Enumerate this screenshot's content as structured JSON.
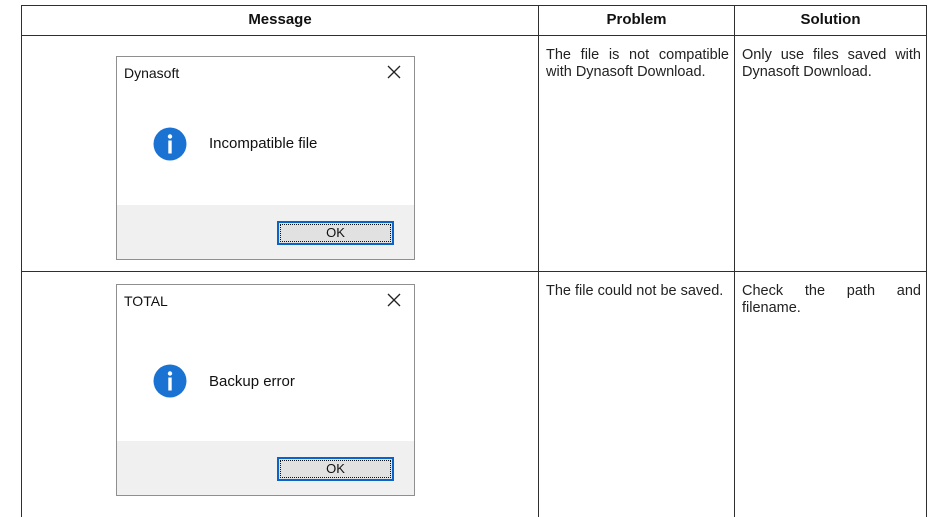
{
  "table": {
    "headers": {
      "message": "Message",
      "problem": "Problem",
      "solution": "Solution"
    },
    "rows": [
      {
        "dialog": {
          "title": "Dynasoft",
          "message": "Incompatible file",
          "ok_label": "OK",
          "icon": "info-icon",
          "close_icon": "close-icon"
        },
        "problem": "The file is not compatible with Dynasoft Download.",
        "solution": "Only use files saved with Dynasoft Download."
      },
      {
        "dialog": {
          "title": "TOTAL",
          "message": "Backup error",
          "ok_label": "OK",
          "icon": "info-icon",
          "close_icon": "close-icon"
        },
        "problem": "The file could not be saved.",
        "solution": "Check the path and filename."
      }
    ]
  },
  "colors": {
    "info_icon": "#1a73d2",
    "ok_button_border": "#0a64c8",
    "dialog_footer": "#f0f0f0"
  }
}
